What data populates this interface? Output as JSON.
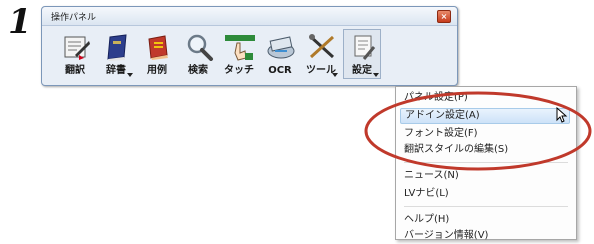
{
  "step_number": "1",
  "panel": {
    "title": "操作パネル",
    "close_glyph": "×",
    "tools": [
      {
        "label": "翻訳",
        "icon": "translate-icon",
        "has_dropdown": false
      },
      {
        "label": "辞書",
        "icon": "dictionary-icon",
        "has_dropdown": true
      },
      {
        "label": "用例",
        "icon": "examples-book-icon",
        "has_dropdown": false
      },
      {
        "label": "検索",
        "icon": "search-magnifier-icon",
        "has_dropdown": false
      },
      {
        "label": "タッチ",
        "icon": "touch-translate-icon",
        "has_dropdown": false
      },
      {
        "label": "OCR",
        "icon": "scanner-icon",
        "has_dropdown": false
      },
      {
        "label": "ツール",
        "icon": "tools-icon",
        "has_dropdown": true
      },
      {
        "label": "設定",
        "icon": "settings-icon",
        "has_dropdown": true,
        "pressed": true
      }
    ]
  },
  "settings_menu": {
    "items": [
      {
        "label": "パネル設定(P)"
      },
      {
        "label": "アドイン設定(A)",
        "hovered": true
      },
      {
        "label": "フォント設定(F)"
      },
      {
        "label": "翻訳スタイルの編集(S)"
      },
      {
        "label": "ニュース(N)"
      },
      {
        "label": "LVナビ(L)"
      },
      {
        "label": "ヘルプ(H)"
      },
      {
        "label": "バージョン情報(V)"
      }
    ]
  },
  "colors": {
    "highlight_ring": "#c0392b",
    "panel_background": "#e8eef6",
    "hover_background": "#cde2f8"
  }
}
